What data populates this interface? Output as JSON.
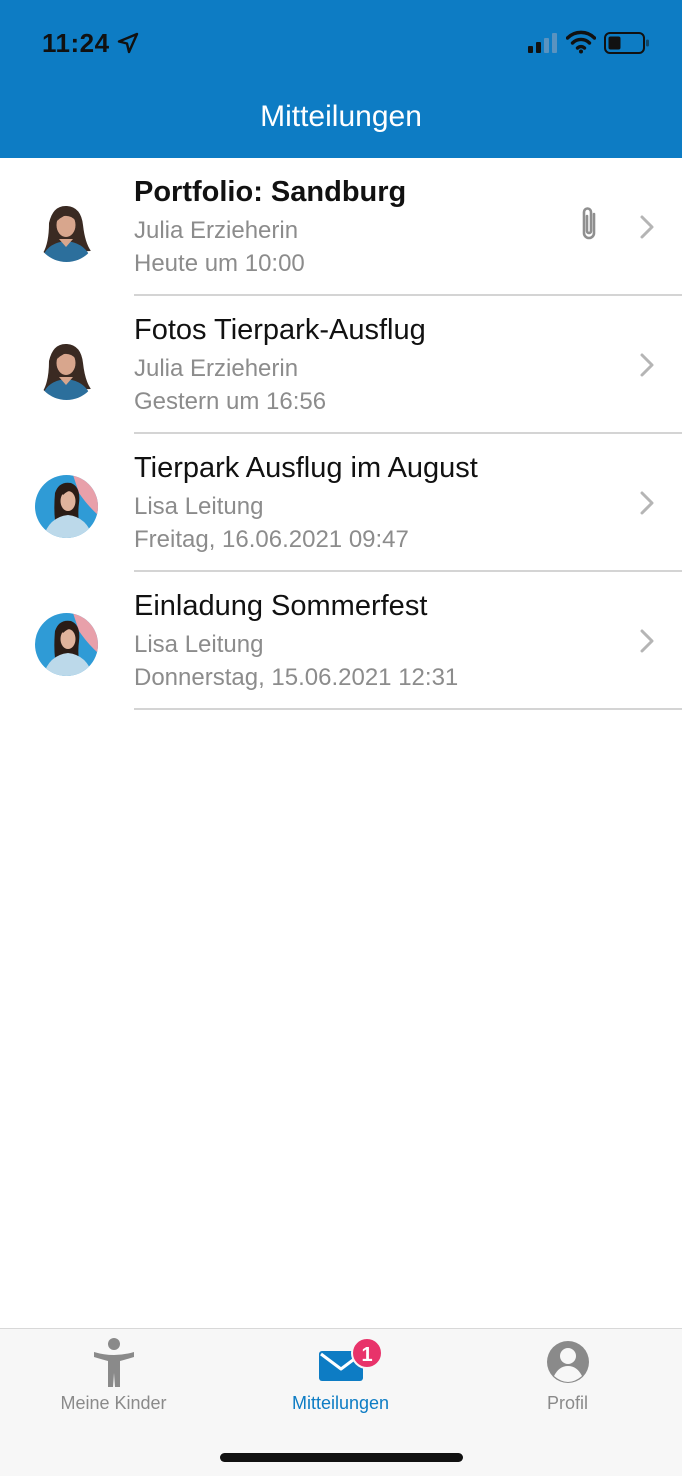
{
  "status_bar": {
    "time": "11:24",
    "icons": [
      "location-arrow-icon",
      "cellular-signal-icon",
      "wifi-icon",
      "battery-icon"
    ]
  },
  "header": {
    "title": "Mitteilungen",
    "color": "#0d7cc4"
  },
  "messages": [
    {
      "title": "Portfolio: Sandburg",
      "sender": "Julia Erzieherin",
      "date": "Heute um 10:00",
      "unread": true,
      "has_attachment": true,
      "avatar": "julia"
    },
    {
      "title": "Fotos Tierpark-Ausflug",
      "sender": "Julia Erzieherin",
      "date": "Gestern um 16:56",
      "unread": false,
      "has_attachment": false,
      "avatar": "julia"
    },
    {
      "title": "Tierpark Ausflug im August",
      "sender": "Lisa Leitung",
      "date": "Freitag, 16.06.2021 09:47",
      "unread": false,
      "has_attachment": false,
      "avatar": "lisa"
    },
    {
      "title": "Einladung Sommerfest",
      "sender": "Lisa Leitung",
      "date": "Donnerstag, 15.06.2021 12:31",
      "unread": false,
      "has_attachment": false,
      "avatar": "lisa"
    }
  ],
  "tabbar": {
    "tabs": [
      {
        "label": "Meine Kinder",
        "icon": "child-figure-icon",
        "active": false
      },
      {
        "label": "Mitteilungen",
        "icon": "envelope-icon",
        "active": true,
        "badge": "1"
      },
      {
        "label": "Profil",
        "icon": "profile-icon",
        "active": false
      }
    ],
    "active_color": "#0d7cc4",
    "badge_color": "#e8336a"
  }
}
